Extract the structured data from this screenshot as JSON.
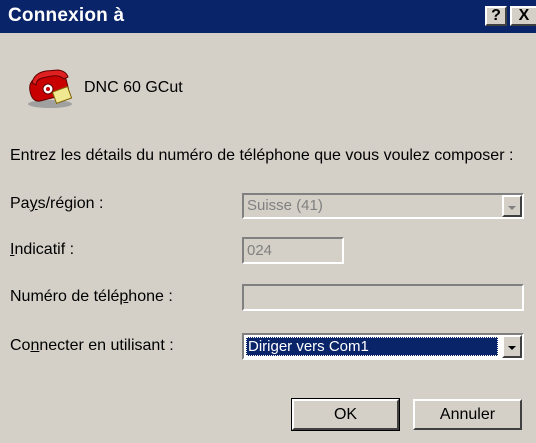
{
  "window": {
    "title": "Connexion à",
    "help_button": "?",
    "close_button": "X"
  },
  "connection": {
    "icon": "telephone-icon",
    "name": "DNC 60 GCut"
  },
  "instructions": "Entrez les détails du numéro de téléphone que vous voulez composer :",
  "fields": {
    "country": {
      "label_pre": "Pa",
      "label_u": "y",
      "label_post": "s/région :",
      "value": "Suisse (41)"
    },
    "area_code": {
      "label_pre": "",
      "label_u": "I",
      "label_post": "ndicatif :",
      "value": "024"
    },
    "phone": {
      "label_pre": "Numéro de télé",
      "label_u": "p",
      "label_post": "hone :",
      "value": ""
    },
    "connect_using": {
      "label_pre": "Co",
      "label_u": "n",
      "label_post": "necter en utilisant :",
      "value": "Diriger vers Com1"
    }
  },
  "buttons": {
    "ok": "OK",
    "cancel": "Annuler"
  },
  "colors": {
    "titlebar": "#0a246a",
    "dialog": "#d4d0c8",
    "selection": "#0a246a"
  }
}
